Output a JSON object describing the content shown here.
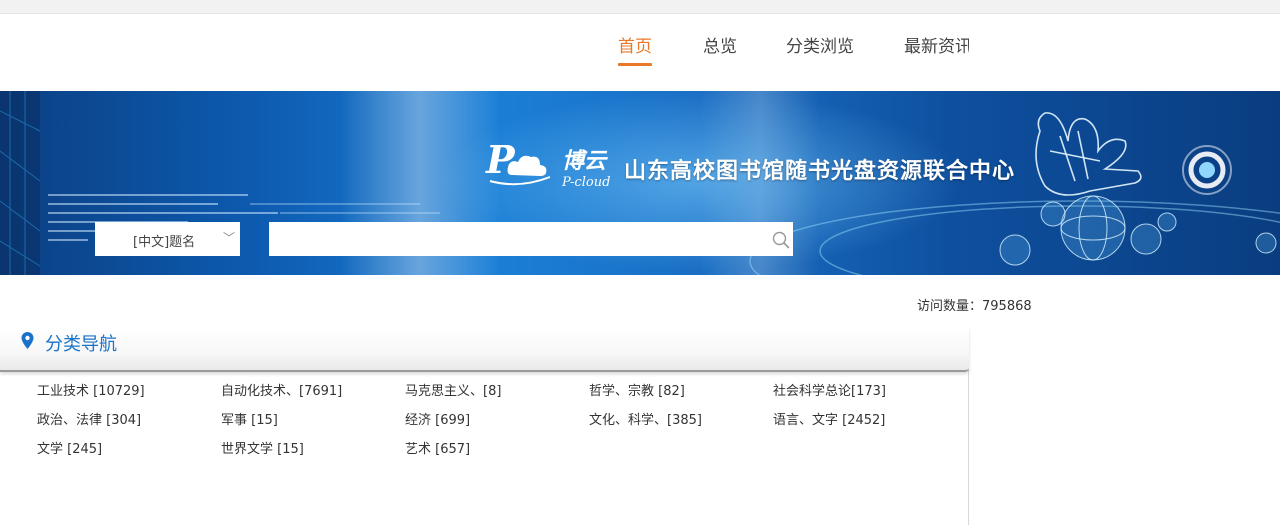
{
  "nav": {
    "items": [
      {
        "label": "首页",
        "active": true
      },
      {
        "label": "总览",
        "active": false
      },
      {
        "label": "分类浏览",
        "active": false
      },
      {
        "label": "最新资讯",
        "active": false
      }
    ],
    "active_color": "#e8792a"
  },
  "banner": {
    "brand_cn": "博云",
    "brand_en": "P-cloud",
    "title": "山东高校图书馆随书光盘资源联合中心"
  },
  "search": {
    "field_selected": "[中文]题名",
    "query": "",
    "placeholder": ""
  },
  "stats": {
    "visit_label": "访问数量：795868"
  },
  "category_nav": {
    "title": "分类导航",
    "title_color": "#1a73c9",
    "items": [
      "工业技术 [10729]",
      "自动化技术、[7691]",
      "马克思主义、[8]",
      "哲学、宗教 [82]",
      "社会科学总论[173]",
      "政治、法律 [304]",
      "军事 [15]",
      "经济 [699]",
      "文化、科学、[385]",
      "语言、文字 [2452]",
      "文学 [245]",
      "世界文学 [15]",
      "艺术 [657]"
    ]
  }
}
